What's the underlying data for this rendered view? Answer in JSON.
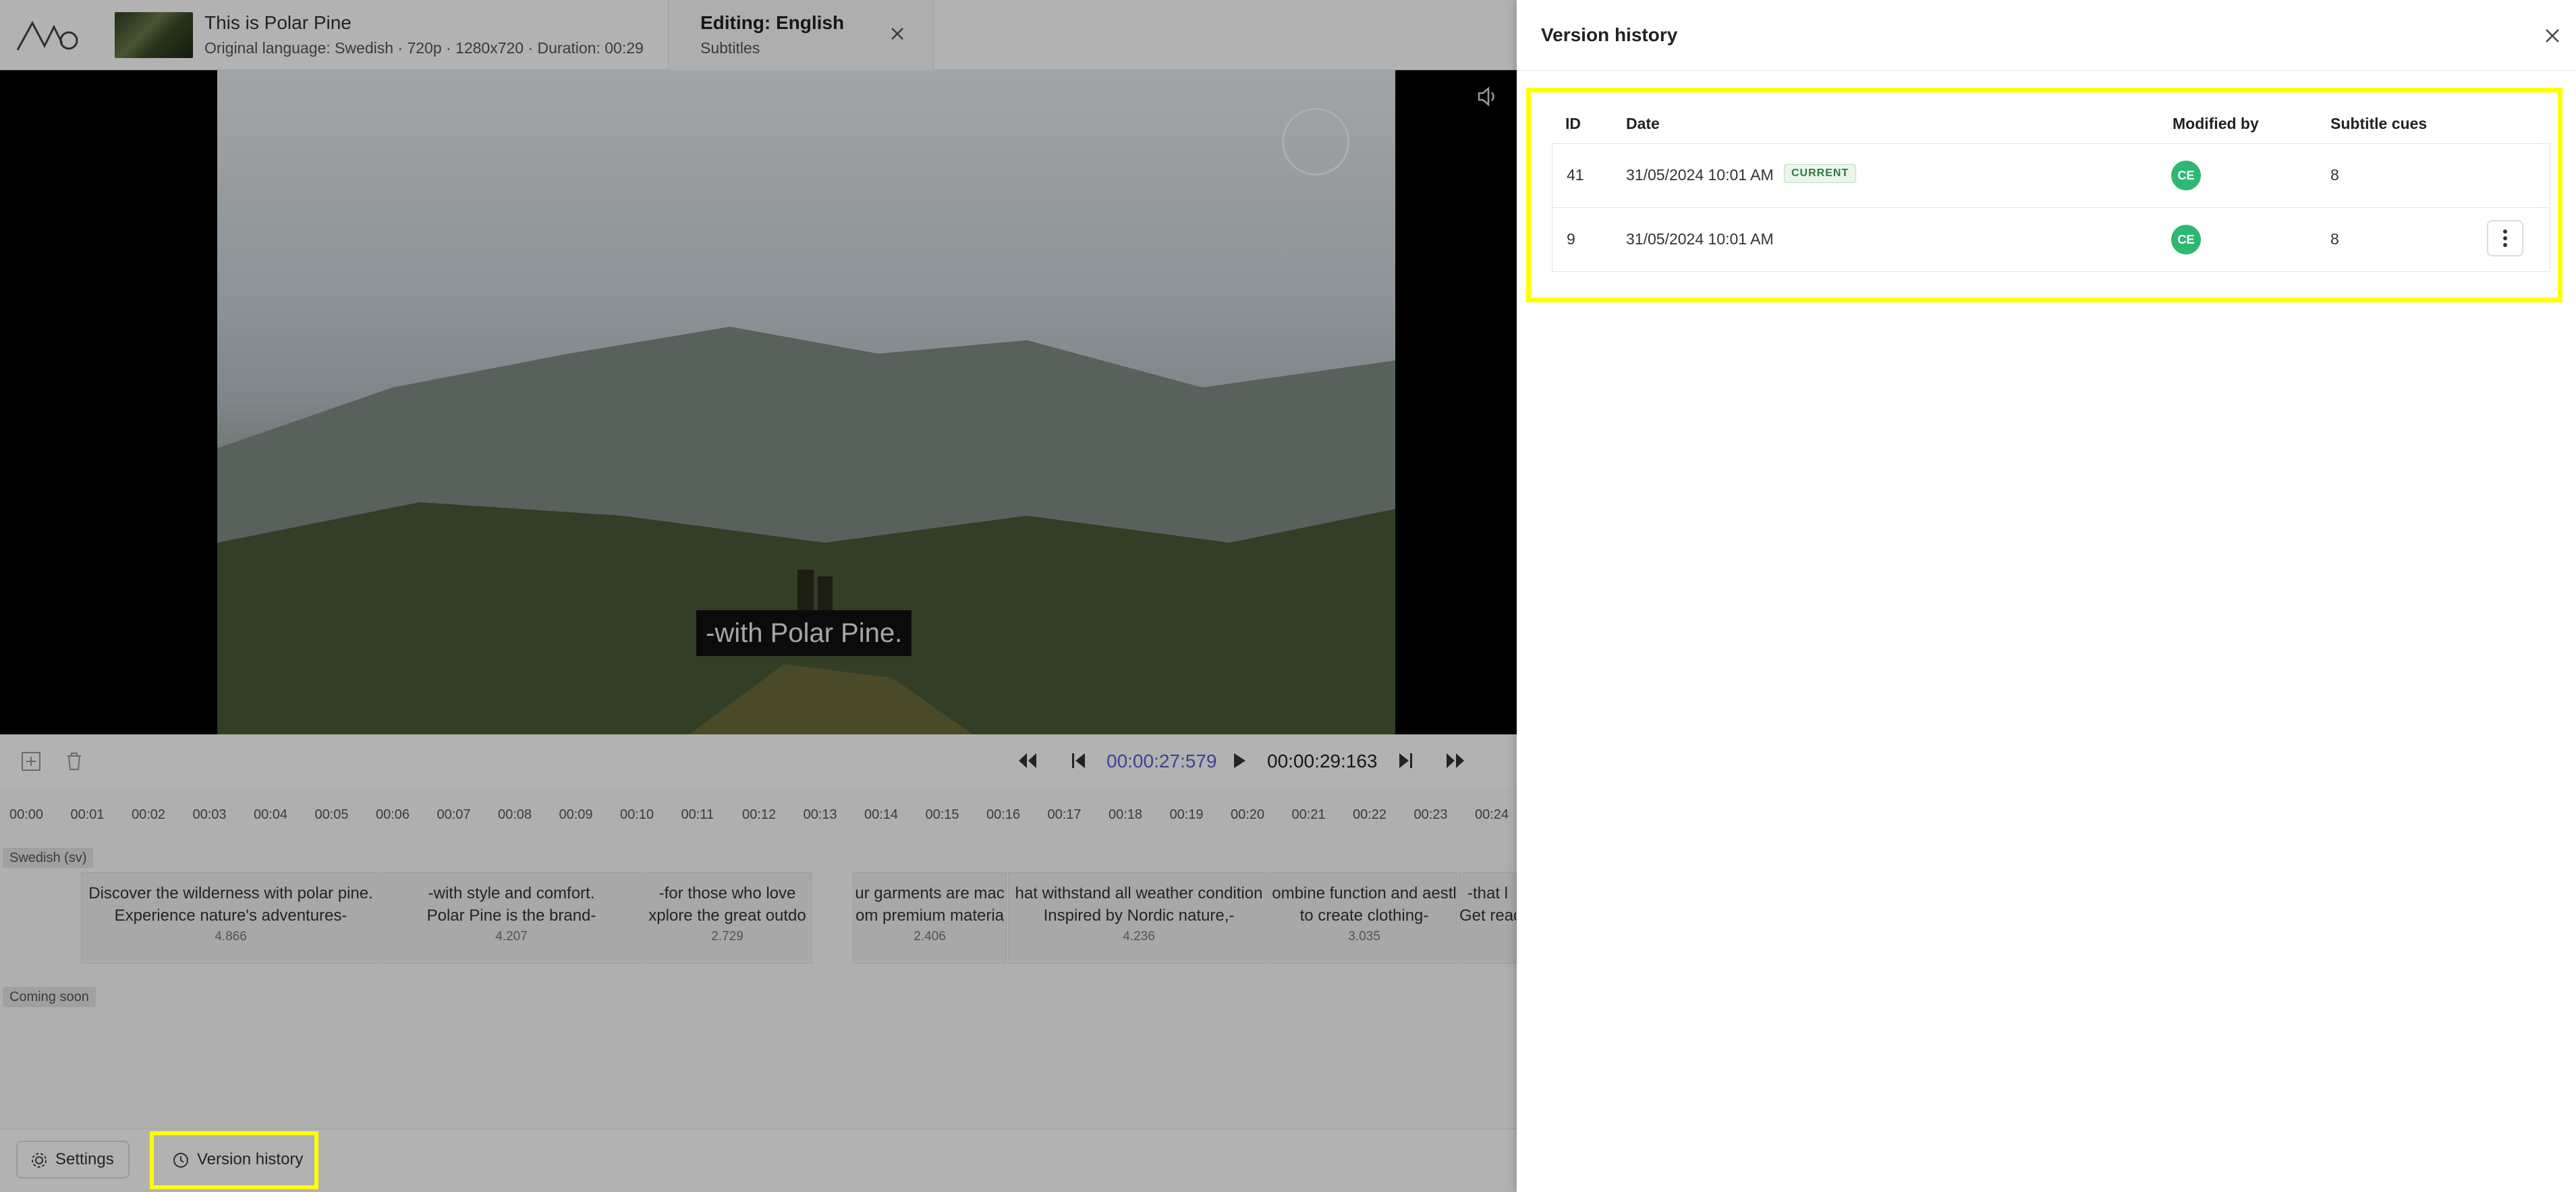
{
  "header": {
    "file_title": "This is Polar Pine",
    "file_meta": "Original language: Swedish · 720p · 1280x720 · Duration: 00:29",
    "editing_title": "Editing: English",
    "editing_sub": "Subtitles"
  },
  "player": {
    "subtitle_overlay": "-with Polar Pine.",
    "current_time": "00:00:27:579",
    "end_time": "00:00:29:163"
  },
  "timeline": {
    "ticks": [
      "00:00",
      "00:01",
      "00:02",
      "00:03",
      "00:04",
      "00:05",
      "00:06",
      "00:07",
      "00:08",
      "00:09",
      "00:10",
      "00:11",
      "00:12",
      "00:13",
      "00:14",
      "00:15",
      "00:16",
      "00:17",
      "00:18",
      "00:19",
      "00:20",
      "00:21",
      "00:22",
      "00:23",
      "00:24"
    ],
    "track_label": "Swedish (sv)",
    "track_label_2": "Coming soon",
    "cues": [
      {
        "text": "Discover the wilderness with polar pine.\nExperience nature's adventures-",
        "duration": "4.866"
      },
      {
        "text": "-with style and comfort.\nPolar Pine is the brand-",
        "duration": "4.207"
      },
      {
        "text": "-for those who love\nxplore the great outdo",
        "duration": "2.729"
      },
      {
        "text": "ur garments are mac\nom premium materia",
        "duration": "2.406"
      },
      {
        "text": "hat withstand all weather condition\nInspired by Nordic nature,-",
        "duration": "4.236"
      },
      {
        "text": "ombine function and aestl\nto create clothing-",
        "duration": "3.035"
      },
      {
        "text": "-that l\nGet read",
        "duration": ""
      }
    ]
  },
  "bottom_bar": {
    "settings_label": "Settings",
    "version_history_label": "Version history"
  },
  "version_panel": {
    "title": "Version history",
    "columns": {
      "id": "ID",
      "date": "Date",
      "modified_by": "Modified by",
      "cues": "Subtitle cues"
    },
    "rows": [
      {
        "id": "41",
        "date": "31/05/2024 10:01 AM",
        "badge": "CURRENT",
        "initials": "CE",
        "cues": "8"
      },
      {
        "id": "9",
        "date": "31/05/2024 10:01 AM",
        "badge": "",
        "initials": "CE",
        "cues": "8"
      }
    ]
  },
  "icons": {
    "logo": "brand-logo-icon",
    "close": "close-icon",
    "more": "more-vertical-icon",
    "gear": "gear-icon",
    "clock": "clock-icon",
    "volume": "volume-icon"
  },
  "colors": {
    "accent": "#5b5fc7",
    "highlight": "#ffff00",
    "avatar": "#2eb872",
    "badge_text": "#2f7a43"
  }
}
